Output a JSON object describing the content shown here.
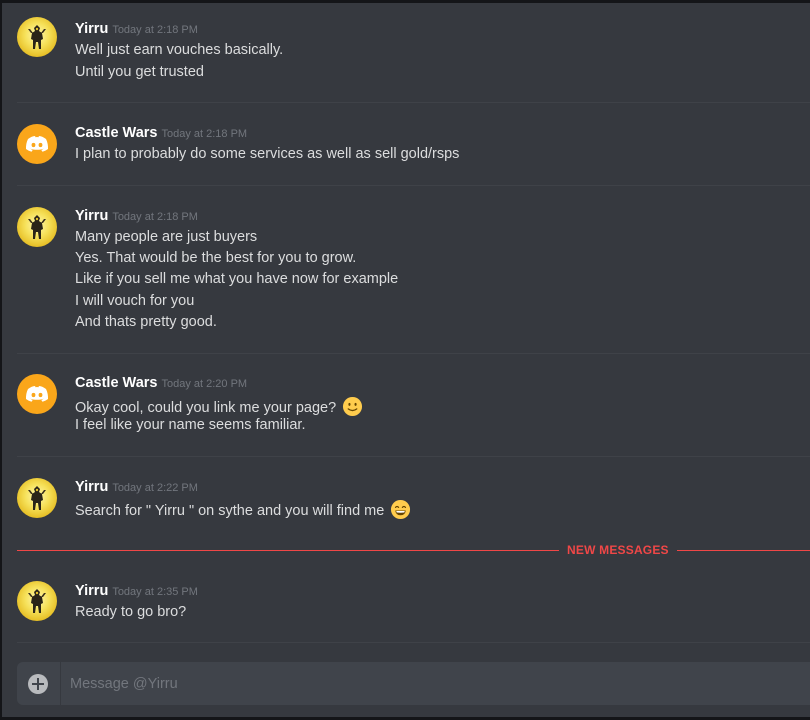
{
  "messages": [
    {
      "author": "Yirru",
      "avatar": "yirru-avatar",
      "timestamp": "Today at 2:18 PM",
      "lines": [
        "Well just earn vouches basically.",
        "Until you get trusted"
      ]
    },
    {
      "author": "Castle Wars",
      "avatar": "discord-logo-avatar",
      "timestamp": "Today at 2:18 PM",
      "lines": [
        "I plan to probably do some services as well as sell gold/rsps"
      ]
    },
    {
      "author": "Yirru",
      "avatar": "yirru-avatar",
      "timestamp": "Today at 2:18 PM",
      "lines": [
        "Many people are just buyers",
        "Yes. That would be the best for you to grow.",
        "Like if you sell me what you have now for example",
        "I will vouch for you",
        "And thats pretty good."
      ]
    },
    {
      "author": "Castle Wars",
      "avatar": "discord-logo-avatar",
      "timestamp": "Today at 2:20 PM",
      "lines": [
        "Okay cool, could you link me your page?",
        "I feel like your name seems familiar."
      ],
      "emoji": "slightly-smiling-face"
    },
    {
      "author": "Yirru",
      "avatar": "yirru-avatar",
      "timestamp": "Today at 2:22 PM",
      "lines": [
        "Search for \" Yirru \" on sythe and you will find me"
      ],
      "emoji": "grinning-face"
    },
    {
      "author": "Yirru",
      "avatar": "yirru-avatar",
      "timestamp": "Today at 2:35 PM",
      "lines": [
        "Ready to go bro?"
      ]
    }
  ],
  "new_messages_label": "NEW MESSAGES",
  "composer": {
    "placeholder": "Message @Yirru",
    "add_icon": "plus-circle-icon"
  },
  "colors": {
    "background": "#36393f",
    "username": "#ffffff",
    "text": "#dcddde",
    "timestamp": "#72767d",
    "new_messages": "#f04747",
    "castle_avatar": "#faa61a",
    "input_bg": "#40444b"
  }
}
